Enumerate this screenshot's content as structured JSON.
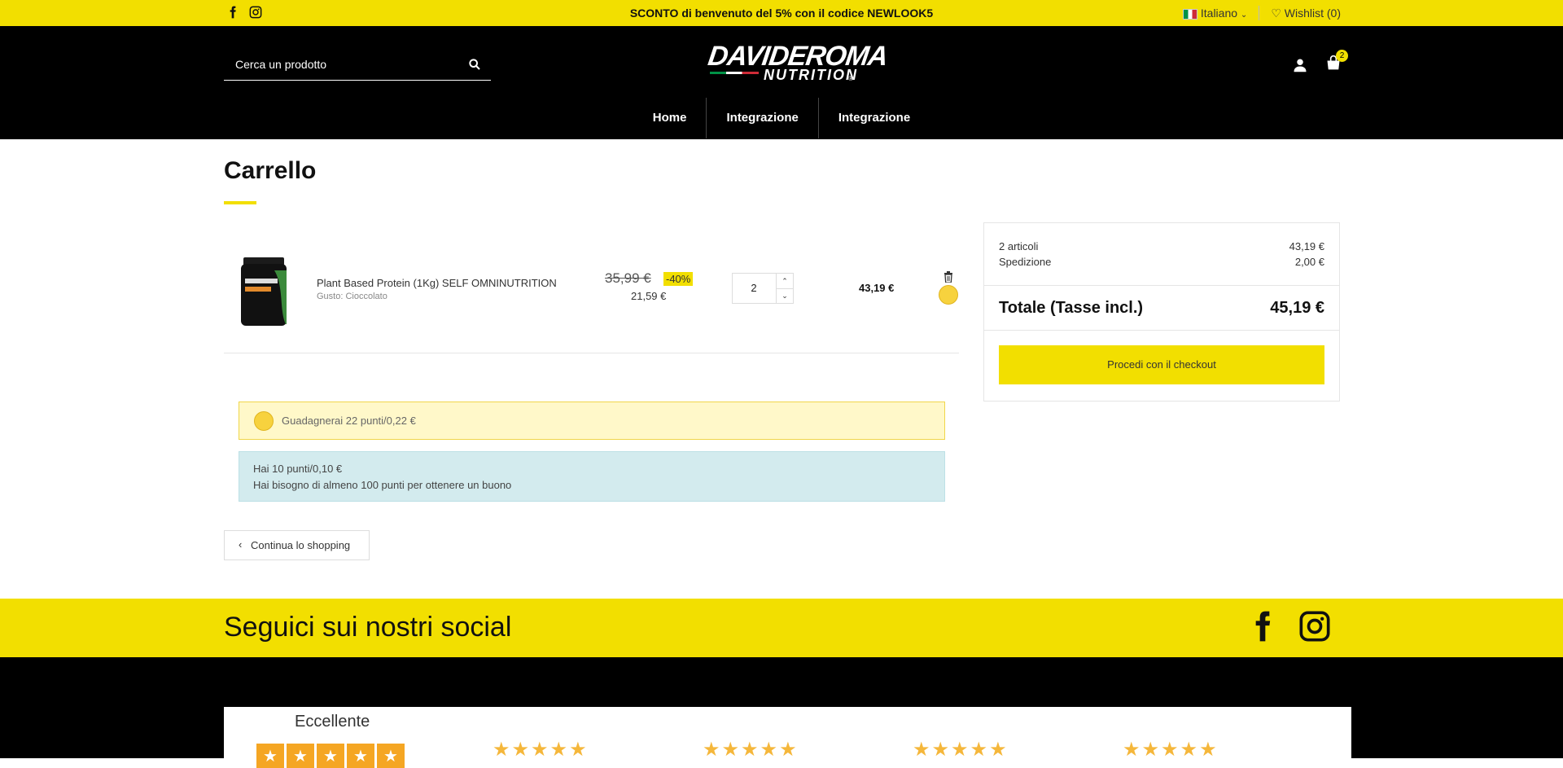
{
  "topbar": {
    "promo": "SCONTO di benvenuto del 5% con il codice NEWLOOK5",
    "language": "Italiano",
    "wishlist": "Wishlist (0)",
    "icons": [
      "facebook-icon",
      "instagram-icon"
    ]
  },
  "header": {
    "search_placeholder": "Cerca un prodotto",
    "logo_line1": "DAVIDEROMA",
    "logo_line2": "NUTRITION",
    "logo_reg": "®",
    "cart_count": "2"
  },
  "nav": {
    "items": [
      "Home",
      "Integrazione",
      "Integrazione"
    ]
  },
  "cart": {
    "title": "Carrello",
    "item": {
      "name": "Plant Based Protein (1Kg) SELF OMNINUTRITION",
      "attribute": "Gusto: Cioccolato",
      "old_price": "35,99 €",
      "discount": "-40%",
      "price": "21,59 €",
      "quantity": "2",
      "total": "43,19 €"
    },
    "points_msg": "Guadagnerai 22 punti/0,22 €",
    "info_line1": "Hai 10 punti/0,10 €",
    "info_line2": "Hai bisogno di almeno 100 punti per ottenere un buono",
    "continue": "Continua lo shopping"
  },
  "summary": {
    "items_label": "2 articoli",
    "items_value": "43,19 €",
    "shipping_label": "Spedizione",
    "shipping_value": "2,00 €",
    "total_label": "Totale (Tasse incl.)",
    "total_value": "45,19 €",
    "checkout": "Procedi con il checkout"
  },
  "footer": {
    "social_heading": "Seguici sui nostri social",
    "review_label": "Eccellente"
  },
  "colors": {
    "accent": "#f2df00",
    "header_bg": "#000000",
    "points_bg": "#fff8c9",
    "info_bg": "#d3ebee"
  }
}
